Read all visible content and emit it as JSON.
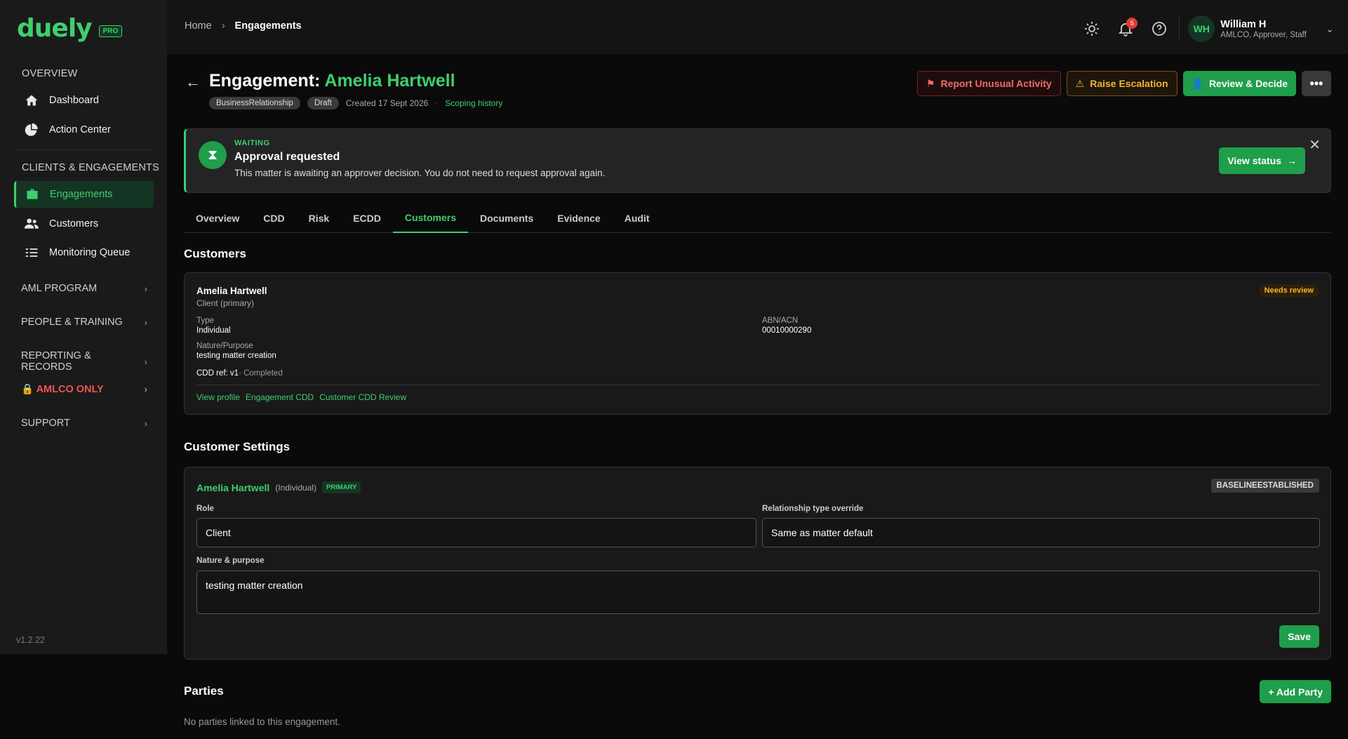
{
  "brand": {
    "name": "duely",
    "badge": "PRO",
    "version": "v1.2.22"
  },
  "sidebar": {
    "overview_head": "OVERVIEW",
    "overview_items": [
      {
        "label": "Dashboard"
      },
      {
        "label": "Action Center"
      }
    ],
    "clients_head": "CLIENTS & ENGAGEMENTS",
    "clients_items": [
      {
        "label": "Engagements"
      },
      {
        "label": "Customers"
      },
      {
        "label": "Monitoring Queue"
      }
    ],
    "groups": [
      {
        "label": "AML PROGRAM"
      },
      {
        "label": "PEOPLE & TRAINING"
      },
      {
        "label": "REPORTING & RECORDS"
      },
      {
        "label": "AMLCO ONLY"
      },
      {
        "label": "SUPPORT"
      }
    ]
  },
  "topbar": {
    "breadcrumb": {
      "home": "Home",
      "current": "Engagements"
    },
    "notifications": "5",
    "user": {
      "initials": "WH",
      "name": "William H",
      "roles": "AMLCO, Approver, Staff"
    }
  },
  "header": {
    "title_prefix": "Engagement:",
    "title_name": "Amelia Hartwell",
    "tags": [
      "BusinessRelationship",
      "Draft"
    ],
    "created": "Created 17 Sept 2026",
    "scoping_link": "Scoping history",
    "actions": {
      "report": "Report Unusual Activity",
      "escalate": "Raise Escalation",
      "review": "Review & Decide"
    }
  },
  "banner": {
    "status": "WAITING",
    "heading": "Approval requested",
    "message": "This matter is awaiting an approver decision. You do not need to request approval again.",
    "button": "View status"
  },
  "tabs": [
    {
      "label": "Overview"
    },
    {
      "label": "CDD"
    },
    {
      "label": "Risk"
    },
    {
      "label": "ECDD"
    },
    {
      "label": "Customers"
    },
    {
      "label": "Documents"
    },
    {
      "label": "Evidence"
    },
    {
      "label": "Audit"
    }
  ],
  "customers": {
    "heading": "Customers",
    "card": {
      "name": "Amelia Hartwell",
      "role": "Client (primary)",
      "badge": "Needs review",
      "type_label": "Type",
      "type_value": "Individual",
      "abn_label": "ABN/ACN",
      "abn_value": "00010000290",
      "nature_label": "Nature/Purpose",
      "nature_value": "testing matter creation",
      "cdd_ref": "CDD ref: v1",
      "cdd_status": "· Completed",
      "links": [
        "View profile",
        "Engagement CDD",
        "Customer CDD Review"
      ]
    }
  },
  "settings": {
    "heading": "Customer Settings",
    "name": "Amelia Hartwell",
    "type": "(Individual)",
    "primary": "PRIMARY",
    "baseline": "BASELINEESTABLISHED",
    "role_label": "Role",
    "role_value": "Client",
    "override_label": "Relationship type override",
    "override_value": "Same as matter default",
    "nature_label": "Nature & purpose",
    "nature_value": "testing matter creation",
    "save": "Save"
  },
  "parties": {
    "heading": "Parties",
    "add": "+ Add Party",
    "empty": "No parties linked to this engagement."
  }
}
